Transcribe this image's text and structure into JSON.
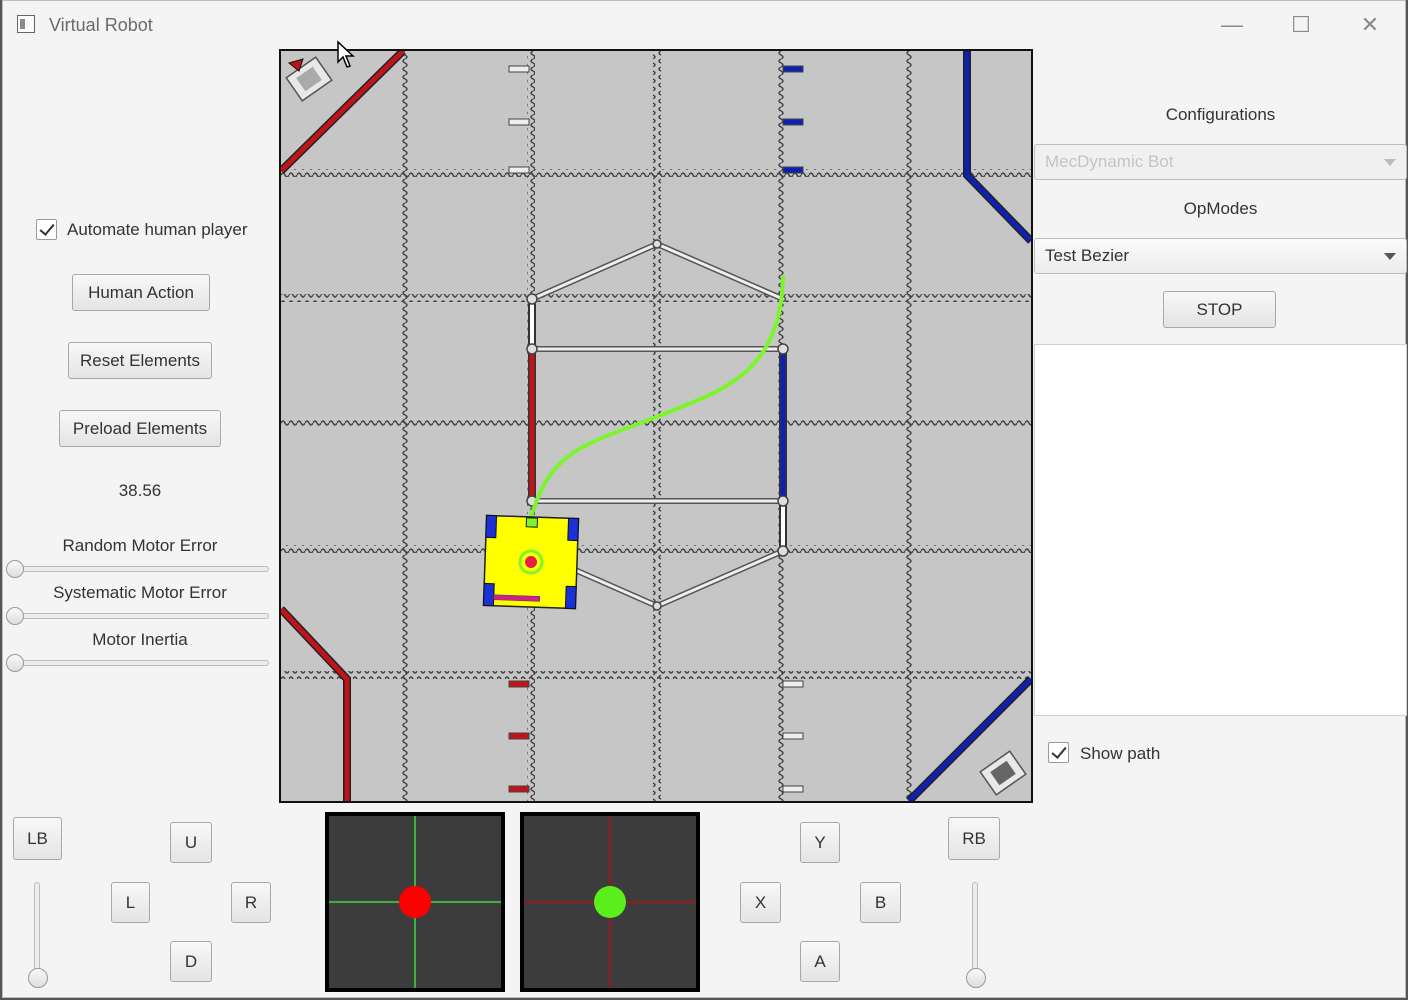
{
  "window": {
    "title": "Virtual Robot"
  },
  "left_panel": {
    "automate_label": "Automate human player",
    "automate_checked": true,
    "human_action": "Human Action",
    "reset_elements": "Reset Elements",
    "preload_elements": "Preload Elements",
    "value_readout": "38.56",
    "random_motor_error": "Random Motor Error",
    "systematic_motor_error": "Systematic Motor Error",
    "motor_inertia": "Motor Inertia"
  },
  "right_panel": {
    "configurations_label": "Configurations",
    "configuration_value": "MecDynamic Bot",
    "opmodes_label": "OpModes",
    "opmode_value": "Test Bezier",
    "stop_label": "STOP",
    "show_path_label": "Show path",
    "show_path_checked": true
  },
  "gamepad": {
    "lb": "LB",
    "rb": "RB",
    "u": "U",
    "l": "L",
    "r": "R",
    "d": "D",
    "y": "Y",
    "x": "X",
    "b": "B",
    "a": "A"
  },
  "colors": {
    "red_alliance": "#c0141c",
    "blue_alliance": "#1020b0",
    "robot": "#ffff00",
    "path": "#7cf52b",
    "joystick_left": "#ff0000",
    "joystick_right": "#5aee1a"
  }
}
